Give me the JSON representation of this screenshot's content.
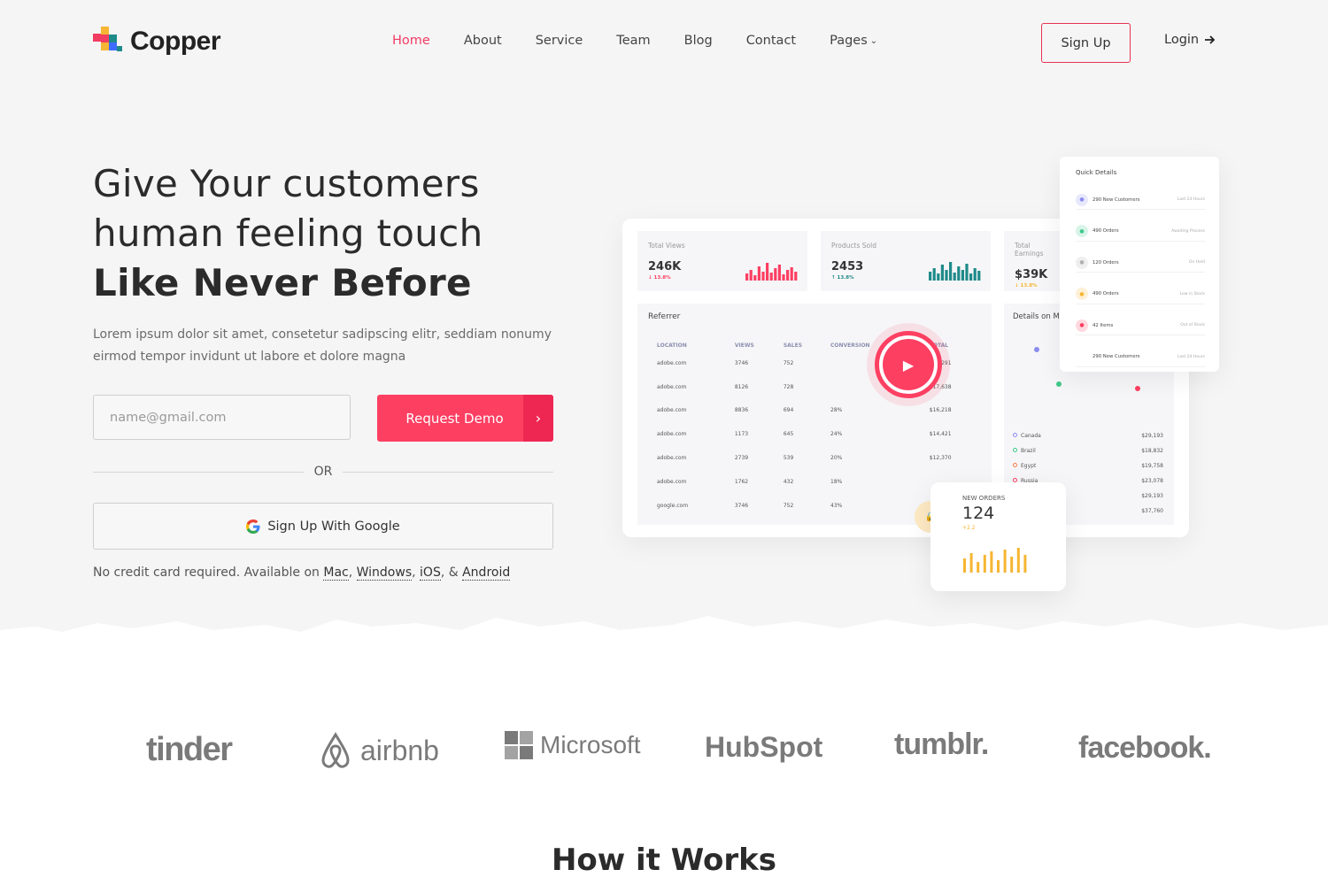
{
  "nav": {
    "logo": "Copper",
    "items": [
      {
        "label": "Home",
        "active": true
      },
      {
        "label": "About"
      },
      {
        "label": "Service"
      },
      {
        "label": "Team"
      },
      {
        "label": "Blog"
      },
      {
        "label": "Contact"
      },
      {
        "label": "Pages",
        "icon": "chevron-down-icon"
      }
    ],
    "signup": "Sign Up",
    "login": "Login"
  },
  "hero": {
    "line1": "Give Your customers",
    "line2": "human feeling touch",
    "line3": "Like Never Before",
    "lead": "Lorem ipsum dolor sit amet, consetetur sadipscing elitr, seddiam nonumy eirmod tempor invidunt ut labore et dolore magna",
    "email_placeholder": "name@gmail.com",
    "demo_button": "Request Demo",
    "or": "OR",
    "google_button": "Sign Up With Google",
    "note_prefix": "No credit card required. Available on ",
    "platforms": [
      "Mac",
      "Windows",
      "iOS",
      "Android"
    ],
    "accent": "#fd3f62"
  },
  "dashboard": {
    "stats": [
      {
        "label": "Total Views",
        "value": "246K",
        "change": "↓ 13.8%",
        "color": "#fd3f62"
      },
      {
        "label": "Products Sold",
        "value": "2453",
        "change": "↑ 13.8%",
        "color": "#1f8a8a"
      },
      {
        "label": "Total Earnings",
        "value": "$39K",
        "change": "↓ 13.8%",
        "color": "#f6b532"
      }
    ],
    "referrer": {
      "title": "Referrer",
      "columns": [
        "LOCATION",
        "VIEWS",
        "SALES",
        "CONVERSION",
        "TOTAL"
      ],
      "rows": [
        [
          "adobe.com",
          "3746",
          "752",
          "",
          "$19,291"
        ],
        [
          "adobe.com",
          "8126",
          "728",
          "",
          "$17,638"
        ],
        [
          "adobe.com",
          "8836",
          "694",
          "28%",
          "$16,218"
        ],
        [
          "adobe.com",
          "1173",
          "645",
          "24%",
          "$14,421"
        ],
        [
          "adobe.com",
          "2739",
          "539",
          "20%",
          "$12,370"
        ],
        [
          "adobe.com",
          "1762",
          "432",
          "18%",
          ""
        ],
        [
          "google.com",
          "3746",
          "752",
          "43%",
          ""
        ]
      ]
    },
    "map": {
      "title": "Details on M",
      "countries": [
        {
          "name": "Canada",
          "value": "$29,193"
        },
        {
          "name": "Brazil",
          "value": "$18,832"
        },
        {
          "name": "Egypt",
          "value": "$19,758"
        },
        {
          "name": "Russia",
          "value": "$23,078"
        },
        {
          "name": "",
          "value": "$29,193"
        },
        {
          "name": "",
          "value": "$37,760"
        }
      ]
    },
    "quick": {
      "title": "Quick Details",
      "rows": [
        {
          "label": "290 New Customers",
          "status": "Last 24 Hours",
          "color": "#8b8cf0"
        },
        {
          "label": "490 Orders",
          "status": "Awaiting Process",
          "color": "#3ec98a"
        },
        {
          "label": "120 Orders",
          "status": "On Hold",
          "color": "#b0b0b0"
        },
        {
          "label": "490 Orders",
          "status": "Low in Stock",
          "color": "#f6b532"
        },
        {
          "label": "42 Items",
          "status": "Out of Stock",
          "color": "#fd3f62"
        },
        {
          "label": "290 New Customers",
          "status": "Last 24 Hours",
          "color": "#ffffff"
        }
      ]
    },
    "orders": {
      "label": "NEW ORDERS",
      "value": "124",
      "change": "+2.2"
    }
  },
  "brands": [
    "tinder",
    "airbnb",
    "Microsoft",
    "HubSpot",
    "tumblr.",
    "facebook."
  ],
  "how": {
    "light": "How ",
    "bold": "it Works"
  }
}
